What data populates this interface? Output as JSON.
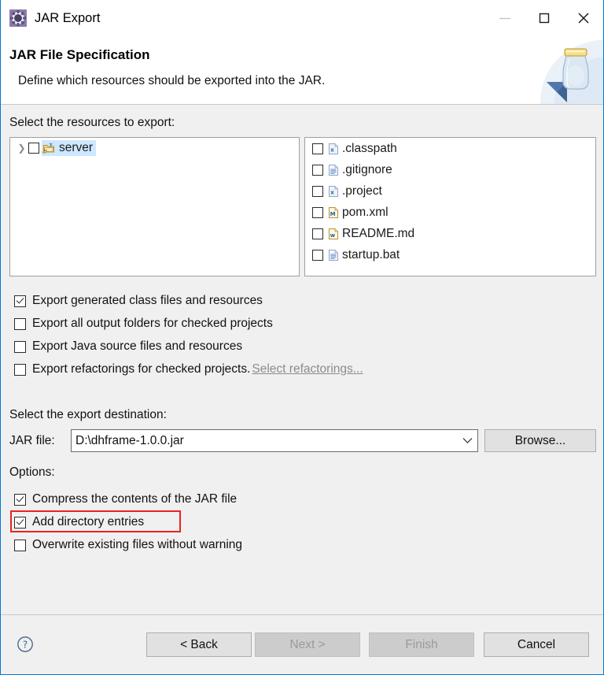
{
  "window": {
    "title": "JAR Export",
    "icon": "jar-export-gear-icon",
    "minimize_label": "Minimize",
    "maximize_label": "Maximize",
    "close_label": "Close"
  },
  "header": {
    "title": "JAR File Specification",
    "description": "Define which resources should be exported into the JAR.",
    "graphic": "jar-banner-icon"
  },
  "resources": {
    "label": "Select the resources to export:",
    "tree": [
      {
        "name": "server",
        "checked": false,
        "expanded": false,
        "selected": true,
        "icon": "java-project-folder-icon"
      }
    ],
    "files": [
      {
        "name": ".classpath",
        "checked": false,
        "icon": "xml-file-icon"
      },
      {
        "name": ".gitignore",
        "checked": false,
        "icon": "text-file-icon"
      },
      {
        "name": ".project",
        "checked": false,
        "icon": "xml-file-icon"
      },
      {
        "name": "pom.xml",
        "checked": false,
        "icon": "maven-file-icon"
      },
      {
        "name": "README.md",
        "checked": false,
        "icon": "markdown-file-icon"
      },
      {
        "name": "startup.bat",
        "checked": false,
        "icon": "text-file-icon"
      }
    ]
  },
  "export_options": [
    {
      "label": "Export generated class files and resources",
      "checked": true,
      "link": null
    },
    {
      "label": "Export all output folders for checked projects",
      "checked": false,
      "link": null
    },
    {
      "label": "Export Java source files and resources",
      "checked": false,
      "link": null
    },
    {
      "label": "Export refactorings for checked projects.",
      "checked": false,
      "link": "Select refactorings..."
    }
  ],
  "destination": {
    "label": "Select the export destination:",
    "jar_file_label": "JAR file:",
    "jar_file_value": "D:\\dhframe-1.0.0.jar",
    "browse_label": "Browse..."
  },
  "options": {
    "label": "Options:",
    "items": [
      {
        "label": "Compress the contents of the JAR file",
        "checked": true,
        "highlighted": false
      },
      {
        "label": "Add directory entries",
        "checked": true,
        "highlighted": true
      },
      {
        "label": "Overwrite existing files without warning",
        "checked": false,
        "highlighted": false
      }
    ]
  },
  "footer": {
    "help_label": "Help",
    "buttons": [
      {
        "label": "< Back",
        "enabled": true
      },
      {
        "label": "Next >",
        "enabled": false
      },
      {
        "label": "Finish",
        "enabled": false
      },
      {
        "label": "Cancel",
        "enabled": true
      }
    ]
  },
  "colors": {
    "accent": "#0078d7",
    "highlight_red": "#e8251f",
    "selection_blue": "#cde8ff",
    "dialog_bg": "#f0f0f0"
  }
}
